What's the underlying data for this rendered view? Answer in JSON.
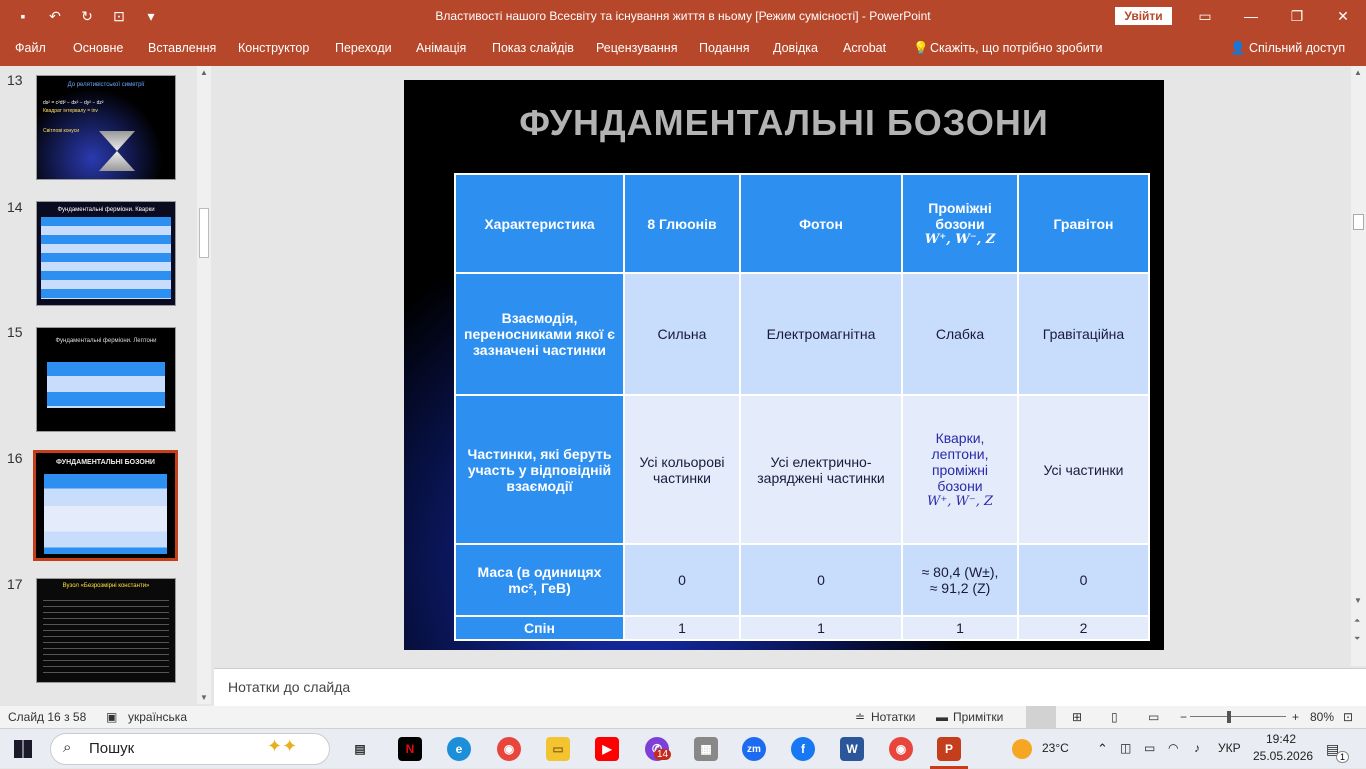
{
  "window": {
    "title": "Властивості нашого Всесвіту та існування життя в ньому [Режим сумісності]  -  PowerPoint",
    "signin_label": "Увійти"
  },
  "ribbon_tabs": [
    "Файл",
    "Основне",
    "Вставлення",
    "Конструктор",
    "Переходи",
    "Анімація",
    "Показ слайдів",
    "Рецензування",
    "Подання",
    "Довідка",
    "Acrobat",
    "Скажіть, що потрібно зробити"
  ],
  "share_label": "Спільний доступ",
  "thumbnails": [
    {
      "num": "13",
      "title": "До релятивістської симетрії",
      "line1": "ds² = c²dt² − dx² − dy² − dz²",
      "line2": "Квадрат інтервалу = inv",
      "line3": "Світлові конуси"
    },
    {
      "num": "14",
      "title": "Фундаментальні ферміони. Кварки"
    },
    {
      "num": "15",
      "title": "Фундаментальні ферміони. Лептони"
    },
    {
      "num": "16",
      "title": "ФУНДАМЕНТАЛЬНІ БОЗОНИ"
    },
    {
      "num": "17",
      "title": "Вузол «Безрозмірні константи»"
    }
  ],
  "slide": {
    "title": "ФУНДАМЕНТАЛЬНІ БОЗОНИ",
    "header": {
      "c0": "Характеристика",
      "c1": "8 Глюонів",
      "c2": "Фотон",
      "c3a": "Проміжні",
      "c3b": "бозони",
      "c3c": "W⁺, W⁻, Z",
      "c4": "Гравітон"
    },
    "row1": {
      "label": "Взаємодія, переносниками якої є зазначені частинки",
      "c1": "Сильна",
      "c2": "Електромагнітна",
      "c3": "Слабка",
      "c4": "Гравітаційна"
    },
    "row2": {
      "label": "Частинки, які беруть участь у відповідній взаємодії",
      "c1": "Усі кольорові частинки",
      "c2": "Усі електрично-заряджені частинки",
      "c3": "Кварки, лептони, проміжні бозони",
      "c3b": "W⁺, W⁻, Z",
      "c4": "Усі частинки"
    },
    "row3": {
      "label_a": "Маса (в одиницях",
      "label_b": "mc², ГеВ)",
      "c1": "0",
      "c2": "0",
      "c3a": "≈ 80,4 (W±),",
      "c3b": "≈ 91,2 (Z)",
      "c4": "0"
    },
    "row4": {
      "label": "Спін",
      "c1": "1",
      "c2": "1",
      "c3": "1",
      "c4": "2"
    }
  },
  "notes_placeholder": "Нотатки до слайда",
  "status": {
    "slide_info": "Слайд 16 з 58",
    "language": "українська",
    "notes_btn": "Нотатки",
    "comments_btn": "Примітки",
    "zoom": "80%"
  },
  "taskbar": {
    "search_placeholder": "Пошук",
    "weather": "23°C",
    "lang": "УКР",
    "time": "19:42",
    "date": "25.05.2026",
    "badge_count": "14",
    "notif_count": "1"
  }
}
